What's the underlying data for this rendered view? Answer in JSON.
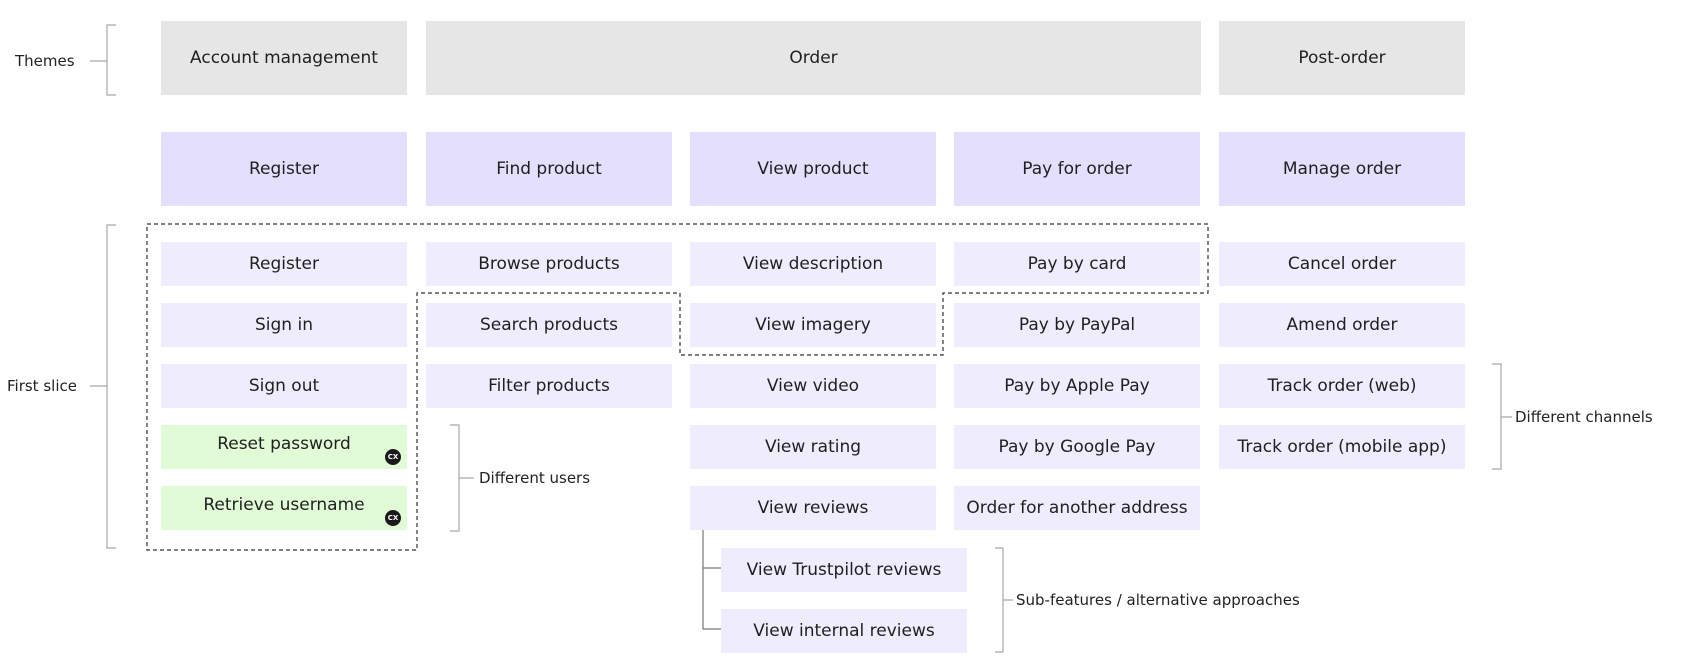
{
  "themes": [
    "Account management",
    "Order",
    "Post-order"
  ],
  "features": [
    "Register",
    "Find product",
    "View product",
    "Pay for order",
    "Manage order"
  ],
  "columns": [
    [
      {
        "text": "Register"
      },
      {
        "text": "Sign in"
      },
      {
        "text": "Sign out"
      },
      {
        "text": "Reset password",
        "badge": "CX"
      },
      {
        "text": "Retrieve username",
        "badge": "CX"
      }
    ],
    [
      {
        "text": "Browse products"
      },
      {
        "text": "Search products"
      },
      {
        "text": "Filter products"
      }
    ],
    [
      {
        "text": "View description"
      },
      {
        "text": "View imagery"
      },
      {
        "text": "View video"
      },
      {
        "text": "View rating"
      },
      {
        "text": "View reviews"
      }
    ],
    [
      {
        "text": "Pay by card"
      },
      {
        "text": "Pay by PayPal"
      },
      {
        "text": "Pay by Apple Pay"
      },
      {
        "text": "Pay by Google Pay"
      },
      {
        "text": "Order for another address"
      }
    ],
    [
      {
        "text": "Cancel order"
      },
      {
        "text": "Amend order"
      },
      {
        "text": "Track order (web)"
      },
      {
        "text": "Track order (mobile app)"
      }
    ]
  ],
  "sub_features": [
    "View Trustpilot reviews",
    "View internal reviews"
  ],
  "annotations": {
    "themes": "Themes",
    "first_slice": "First slice",
    "different_users": "Different users",
    "different_channels": "Different channels",
    "sub_features": "Sub-features / alternative approaches"
  },
  "colors": {
    "theme": "#e6e6e6",
    "feature": "#e3dffc",
    "story": "#eeecfd",
    "cx_story": "#e2fbd7",
    "badge": "#1a1a1a"
  }
}
